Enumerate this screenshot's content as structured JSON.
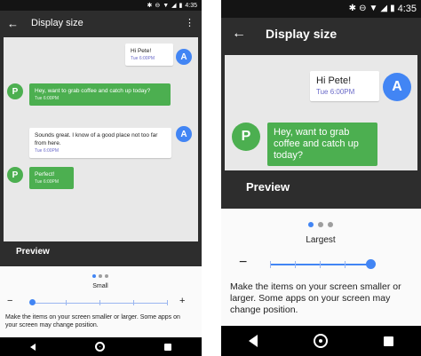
{
  "colors": {
    "toolbar_bg": "#2d2d2d",
    "status_bg": "#141414",
    "accent": "#4285f4",
    "outgoing_bubble": "#4caf50",
    "incoming_bubble": "#ffffff",
    "timestamp_blue": "#6b6bc9",
    "nav_bg": "#000000"
  },
  "screens": {
    "small": {
      "status_bar": {
        "icons": [
          "bluetooth-icon",
          "do-not-disturb-icon",
          "wifi-icon",
          "signal-icon",
          "battery-icon"
        ],
        "time": "4:35"
      },
      "toolbar": {
        "title": "Display size",
        "back_icon": "arrow-back-icon",
        "menu_icon": "more-vert-icon"
      },
      "preview": {
        "label": "Preview",
        "messages": [
          {
            "from": "A",
            "direction": "incoming",
            "text": "Hi Pete!",
            "time": "Tue 6:00PM"
          },
          {
            "from": "P",
            "direction": "outgoing",
            "text": "Hey, want to grab coffee and catch up today?",
            "time": "Tue 6:00PM"
          },
          {
            "from": "A",
            "direction": "incoming",
            "text": "Sounds great. I know of a good place not too far from here.",
            "time": "Tue 6:00PM"
          },
          {
            "from": "P",
            "direction": "outgoing",
            "text": "Perfect!",
            "time": "Tue 6:00PM"
          }
        ]
      },
      "size_control": {
        "label": "Small",
        "page_dot_active": 0,
        "steps": 5,
        "selected_step": 0,
        "minus": "−",
        "plus": "+",
        "description": "Make the items on your screen smaller or larger. Some apps on your screen may change position."
      },
      "nav_bar": {
        "icons": [
          "nav-back-icon",
          "nav-home-icon",
          "nav-recents-icon"
        ]
      }
    },
    "largest": {
      "status_bar": {
        "icons": [
          "bluetooth-icon",
          "do-not-disturb-icon",
          "wifi-icon",
          "signal-icon",
          "battery-icon"
        ],
        "time": "4:35"
      },
      "toolbar": {
        "title": "Display size",
        "back_icon": "arrow-back-icon"
      },
      "preview": {
        "label": "Preview",
        "messages": [
          {
            "from": "A",
            "direction": "incoming",
            "text": "Hi Pete!",
            "time": "Tue 6:00PM"
          },
          {
            "from": "P",
            "direction": "outgoing",
            "text": "Hey, want to grab coffee and catch up today?",
            "time": ""
          }
        ]
      },
      "size_control": {
        "label": "Largest",
        "page_dot_active": 0,
        "steps": 5,
        "selected_step": 4,
        "minus": "−",
        "plus": "",
        "description": "Make the items on your screen smaller or larger. Some apps on your screen may change position."
      },
      "nav_bar": {
        "icons": [
          "nav-back-icon",
          "nav-home-icon",
          "nav-recents-icon"
        ]
      }
    }
  }
}
